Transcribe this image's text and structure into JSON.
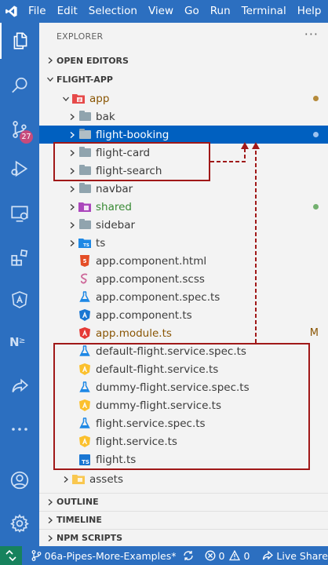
{
  "titlebar": {
    "menu": [
      "File",
      "Edit",
      "Selection",
      "View",
      "Go",
      "Run",
      "Terminal",
      "Help"
    ]
  },
  "activitybar": {
    "items": [
      "explorer-icon",
      "search-icon",
      "source-control-icon",
      "run-debug-icon",
      "remote-explorer-icon",
      "extensions-icon",
      "angular-icon",
      "nx-console-icon",
      "live-share-icon",
      "more-icon",
      "accounts-icon",
      "manage-gear-icon"
    ],
    "source_control_badge": "27"
  },
  "explorer": {
    "header": "EXPLORER",
    "more": "···",
    "open_editors": "OPEN EDITORS",
    "project": "FLIGHT-APP",
    "tree": [
      {
        "label": "app",
        "kind": "folder-app",
        "color": "brown"
      },
      {
        "label": "bak",
        "kind": "folder"
      },
      {
        "label": "flight-booking",
        "kind": "folder",
        "selected": true
      },
      {
        "label": "flight-card",
        "kind": "folder"
      },
      {
        "label": "flight-search",
        "kind": "folder"
      },
      {
        "label": "navbar",
        "kind": "folder"
      },
      {
        "label": "shared",
        "kind": "folder-shared",
        "color": "green"
      },
      {
        "label": "sidebar",
        "kind": "folder"
      },
      {
        "label": "ts",
        "kind": "folder-ts"
      },
      {
        "label": "app.component.html",
        "kind": "html"
      },
      {
        "label": "app.component.scss",
        "kind": "scss"
      },
      {
        "label": "app.component.spec.ts",
        "kind": "spec"
      },
      {
        "label": "app.component.ts",
        "kind": "angular-component"
      },
      {
        "label": "app.module.ts",
        "kind": "angular-module",
        "color": "brown",
        "decoration": "M"
      },
      {
        "label": "default-flight.service.spec.ts",
        "kind": "spec"
      },
      {
        "label": "default-flight.service.ts",
        "kind": "angular-service"
      },
      {
        "label": "dummy-flight.service.spec.ts",
        "kind": "spec"
      },
      {
        "label": "dummy-flight.service.ts",
        "kind": "angular-service"
      },
      {
        "label": "flight.service.spec.ts",
        "kind": "spec"
      },
      {
        "label": "flight.service.ts",
        "kind": "angular-service"
      },
      {
        "label": "flight.ts",
        "kind": "ts"
      },
      {
        "label": "assets",
        "kind": "folder-assets"
      }
    ],
    "outline": "OUTLINE",
    "timeline": "TIMELINE",
    "npm_scripts": "NPM SCRIPTS",
    "modified_decoration": "M"
  },
  "statusbar": {
    "branch": "06a-Pipes-More-Examples*",
    "errors": "0",
    "warnings": "0",
    "live_share": "Live Share"
  },
  "colors": {
    "accent": "#2c6fc0",
    "selection": "#0060c0",
    "annotation": "#a01818",
    "modified": "#895503",
    "untracked": "#388a34"
  }
}
